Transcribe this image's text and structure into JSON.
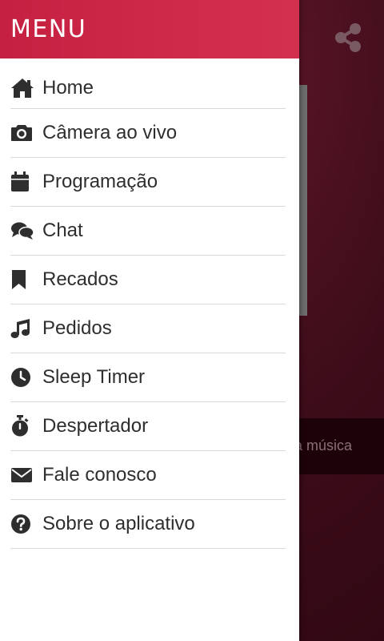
{
  "drawer": {
    "title": "MENU",
    "items": [
      {
        "label": "Home",
        "icon": "home-icon"
      },
      {
        "label": "Câmera ao vivo",
        "icon": "camera-icon"
      },
      {
        "label": "Programação",
        "icon": "calendar-icon"
      },
      {
        "label": "Chat",
        "icon": "chat-icon"
      },
      {
        "label": "Recados",
        "icon": "bookmark-icon"
      },
      {
        "label": "Pedidos",
        "icon": "music-note-icon"
      },
      {
        "label": "Sleep Timer",
        "icon": "clock-icon"
      },
      {
        "label": "Despertador",
        "icon": "stopwatch-icon"
      },
      {
        "label": "Fale conosco",
        "icon": "envelope-icon"
      },
      {
        "label": "Sobre o aplicativo",
        "icon": "question-circle-icon"
      }
    ]
  },
  "background": {
    "share_icon": "share-icon",
    "player_text": "a música"
  },
  "colors": {
    "header": "#d02a49",
    "drawer_bg": "#ffffff",
    "text": "#2e2e2e",
    "divider": "#d9d9d9",
    "app_bg": "#3c0c19"
  }
}
